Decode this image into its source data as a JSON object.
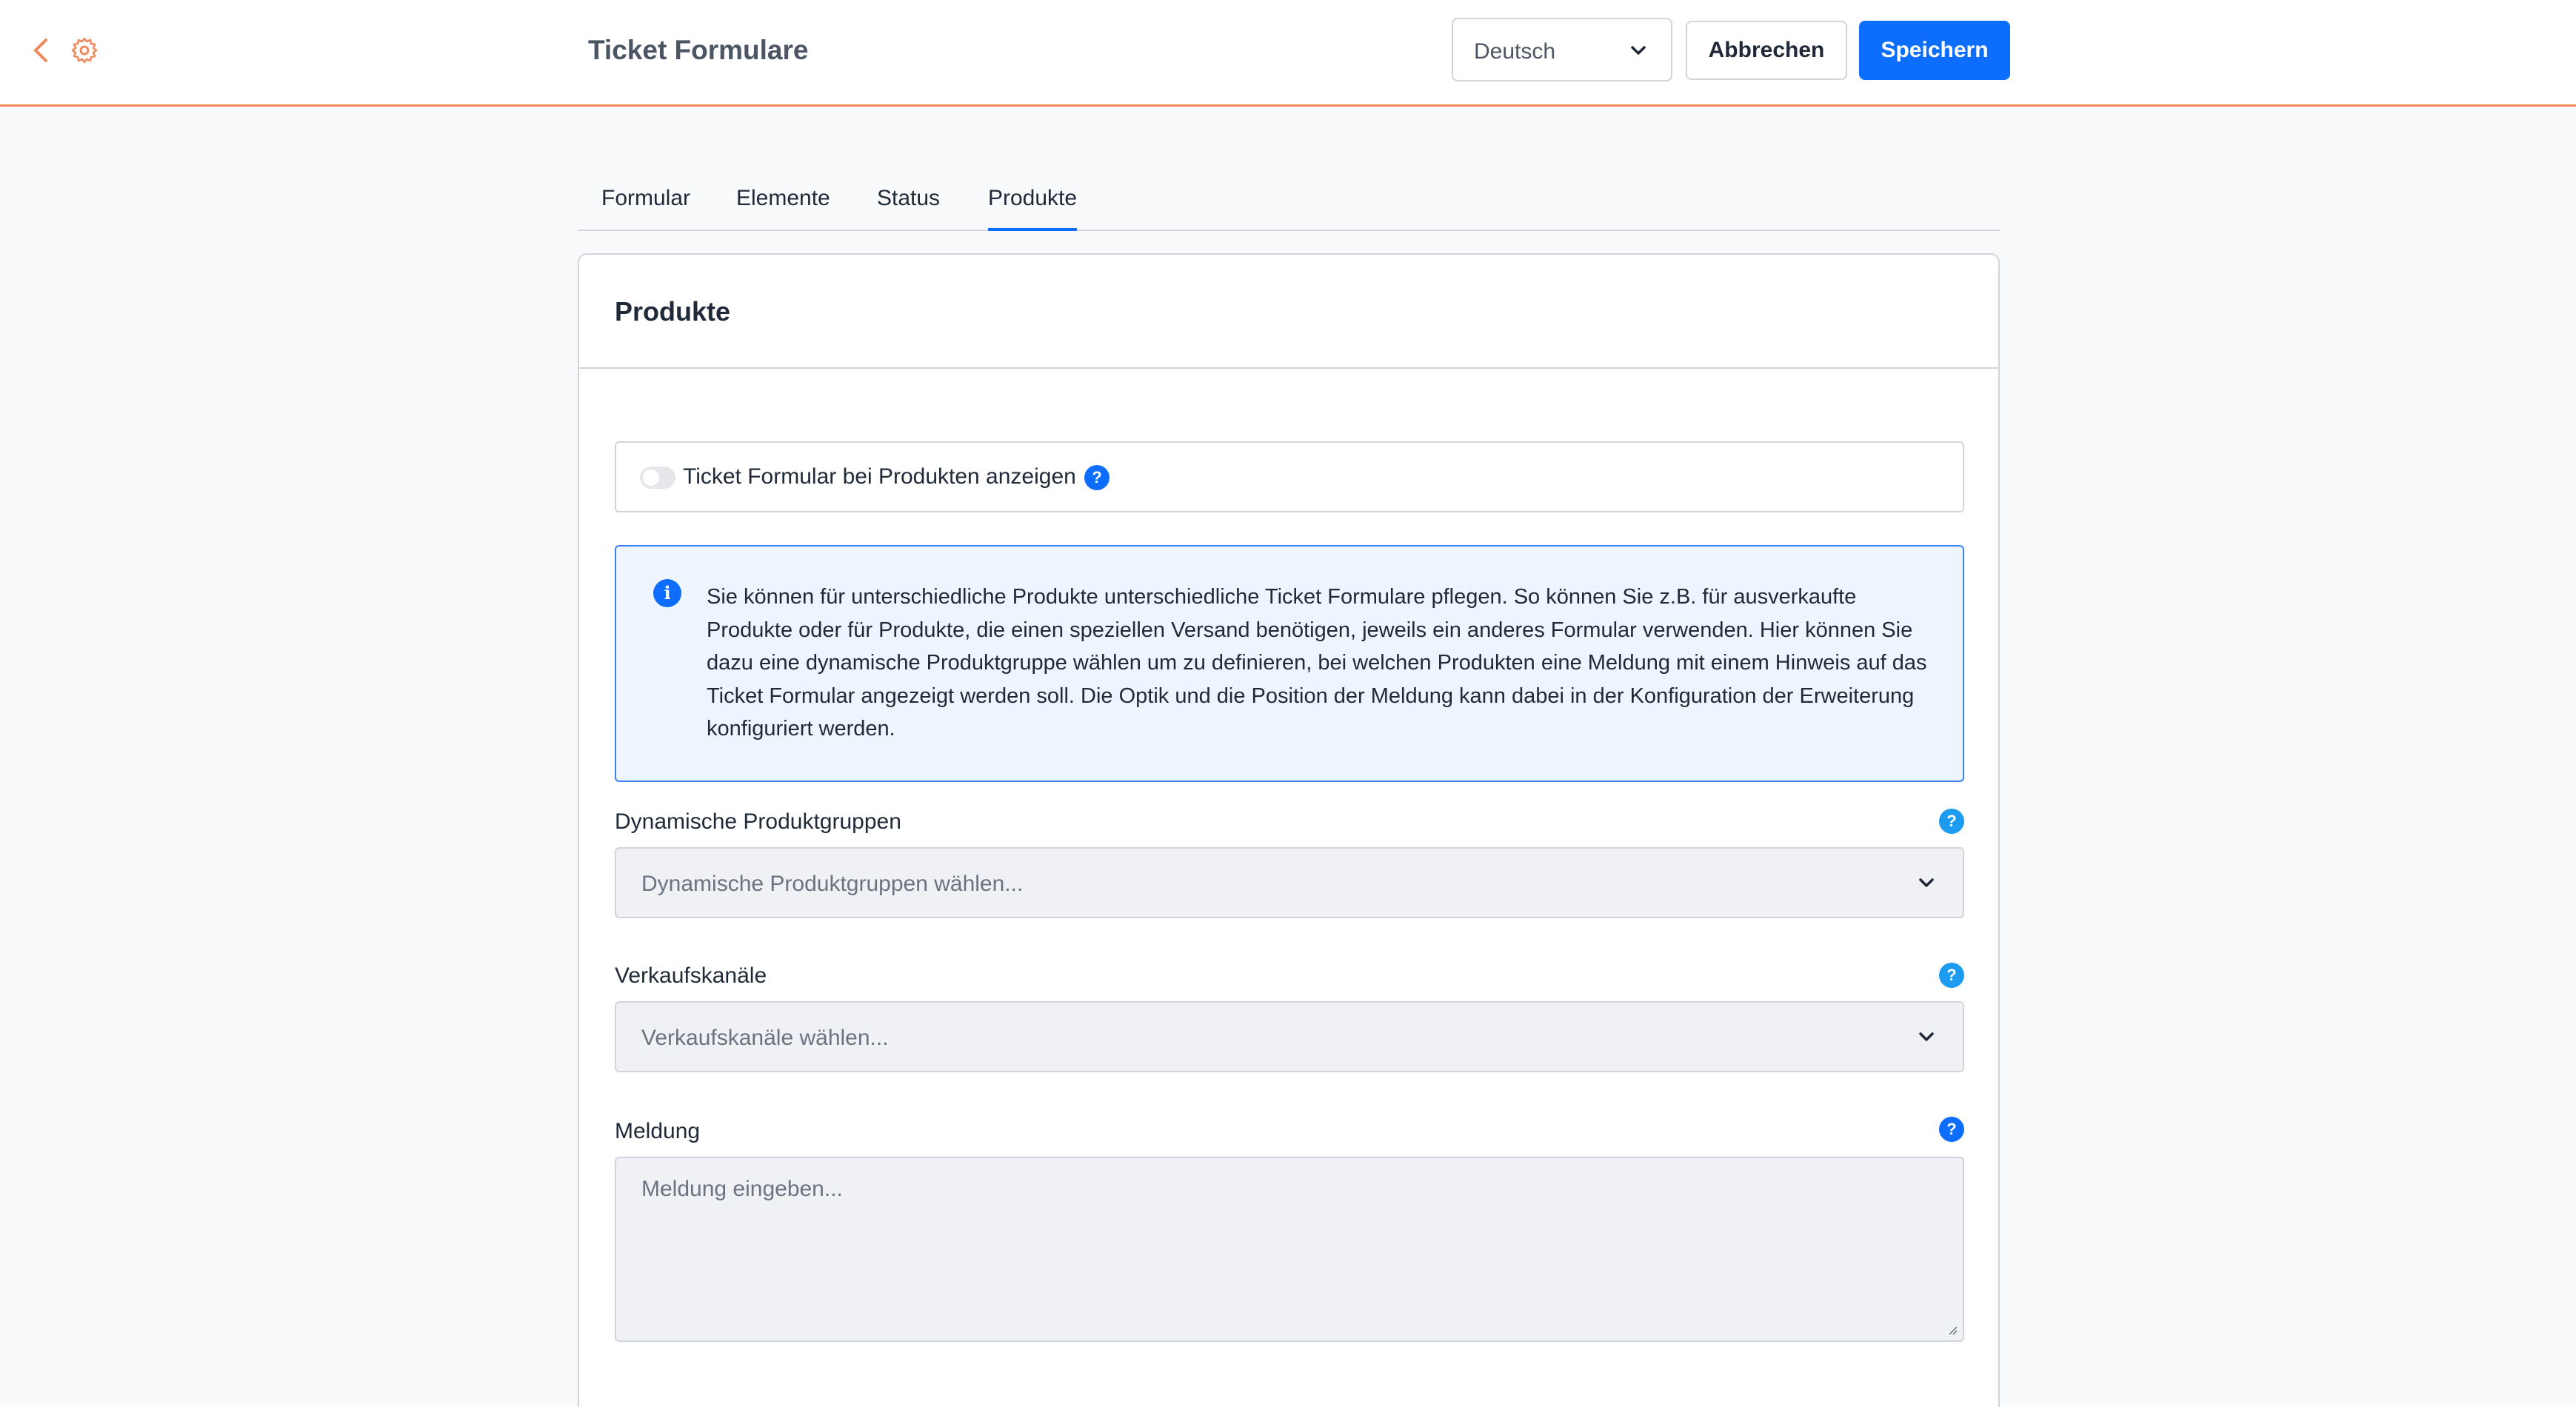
{
  "header": {
    "title": "Ticket Formulare",
    "language": "Deutsch",
    "cancel_label": "Abbrechen",
    "save_label": "Speichern",
    "accent_color": "#f08a5d",
    "primary_color": "#0d6efd"
  },
  "tabs": [
    {
      "label": "Formular",
      "active": false
    },
    {
      "label": "Elemente",
      "active": false
    },
    {
      "label": "Status",
      "active": false
    },
    {
      "label": "Produkte",
      "active": true
    }
  ],
  "card": {
    "title": "Produkte",
    "toggle": {
      "label": "Ticket Formular bei Produkten anzeigen",
      "enabled": false,
      "help": "?"
    },
    "info": {
      "icon": "info-icon",
      "text": "Sie können für unterschiedliche Produkte unterschiedliche Ticket Formulare pflegen. So können Sie z.B. für ausverkaufte Produkte oder für Produkte, die einen speziellen Versand benötigen, jeweils ein anderes Formular verwenden. Hier können Sie dazu eine dynamische Produktgruppe wählen um zu definieren, bei welchen Produkten eine Meldung mit einem Hinweis auf das Ticket Formular angezeigt werden soll. Die Optik und die Position der Meldung kann dabei in der Konfiguration der Erweiterung konfiguriert werden."
    },
    "fields": {
      "product_groups": {
        "label": "Dynamische Produktgruppen",
        "placeholder": "Dynamische Produktgruppen wählen...",
        "help": "?"
      },
      "sales_channels": {
        "label": "Verkaufskanäle",
        "placeholder": "Verkaufskanäle wählen...",
        "help": "?"
      },
      "message": {
        "label": "Meldung",
        "placeholder": "Meldung eingeben...",
        "help": "?"
      }
    }
  }
}
